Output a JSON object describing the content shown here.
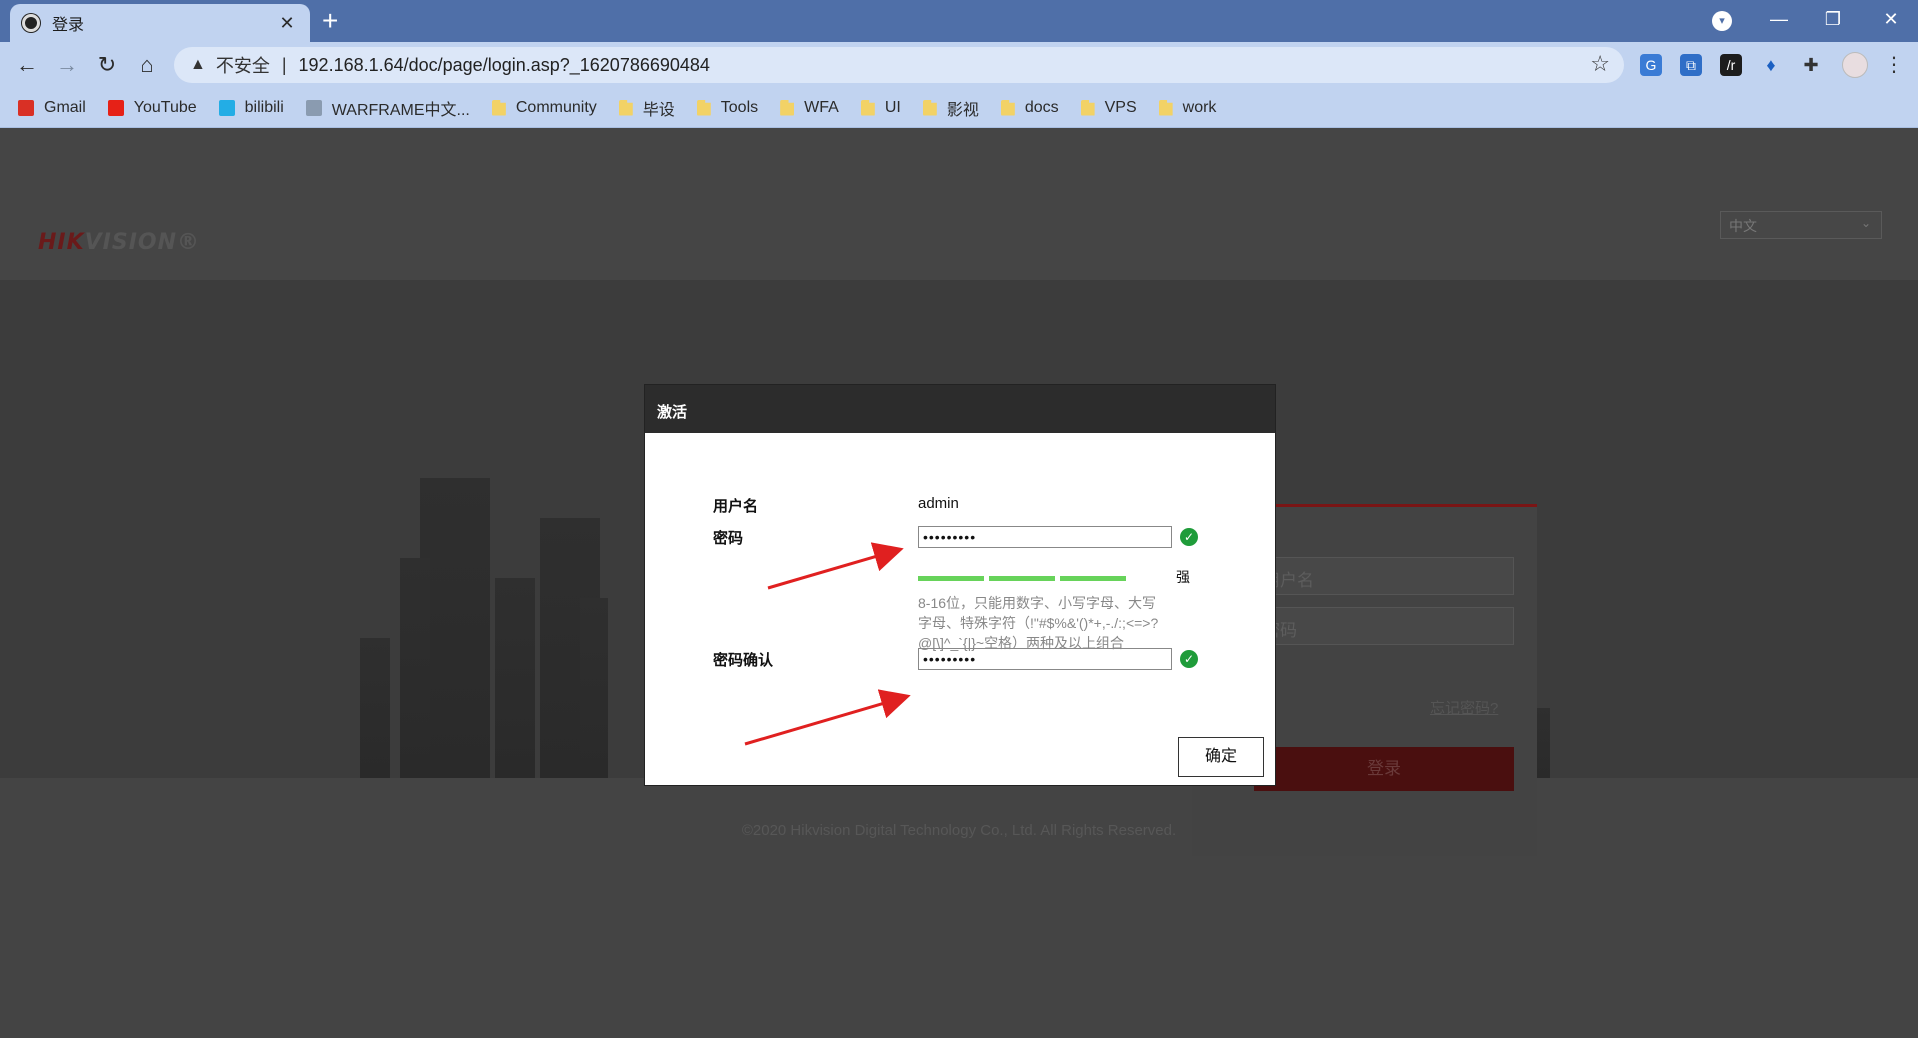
{
  "browser": {
    "tab_title": "登录",
    "tab_close": "✕",
    "new_tab": "+",
    "profile_indicator": "▾",
    "window_minimize": "—",
    "window_restore": "❐",
    "window_close": "✕",
    "security_warning": "不安全",
    "url": "192.168.1.64/doc/page/login.asp?_1620786690484",
    "bookmarks": [
      {
        "label": "Gmail",
        "icon": "gmail-icon",
        "color": "#d93025"
      },
      {
        "label": "YouTube",
        "icon": "youtube-icon",
        "color": "#e62117"
      },
      {
        "label": "bilibili",
        "icon": "bilibili-icon",
        "color": "#23ade5"
      },
      {
        "label": "WARFRAME中文...",
        "icon": "warframe-icon",
        "color": "#8a9bb0"
      },
      {
        "label": "Community",
        "icon": "folder-icon"
      },
      {
        "label": "毕设",
        "icon": "folder-icon"
      },
      {
        "label": "Tools",
        "icon": "folder-icon"
      },
      {
        "label": "WFA",
        "icon": "folder-icon"
      },
      {
        "label": "UI",
        "icon": "folder-icon"
      },
      {
        "label": "影视",
        "icon": "folder-icon"
      },
      {
        "label": "docs",
        "icon": "folder-icon"
      },
      {
        "label": "VPS",
        "icon": "folder-icon"
      },
      {
        "label": "work",
        "icon": "folder-icon"
      }
    ]
  },
  "page": {
    "logo": {
      "part1": "HIK",
      "part2": "VISION",
      "reg": "®"
    },
    "language": "中文",
    "login": {
      "username_placeholder": "用户名",
      "password_placeholder": "密码",
      "forgot_password": "忘记密码?",
      "login_button": "登录"
    },
    "copyright": "©2020 Hikvision Digital Technology Co., Ltd. All Rights Reserved."
  },
  "dialog": {
    "title": "激活",
    "username_label": "用户名",
    "username_value": "admin",
    "password_label": "密码",
    "password_value": "•••••••••",
    "strength_label": "强",
    "strength_level": 3,
    "strength_max": 3,
    "hint": "8-16位，只能用数字、小写字母、大写字母、特殊字符（!\"#$%&'()*+,-./:;<=>?@[\\]^_`{|}~空格）两种及以上组合",
    "confirm_label": "密码确认",
    "confirm_value": "•••••••••",
    "ok_button": "确定"
  },
  "colors": {
    "titlebar": "#4f6fa8",
    "toolbar": "#c1d3f0",
    "brand_red": "#7a1515",
    "check_green": "#1f9c3a",
    "strength_green": "#67d35a",
    "annotation_arrow": "#e02020"
  }
}
